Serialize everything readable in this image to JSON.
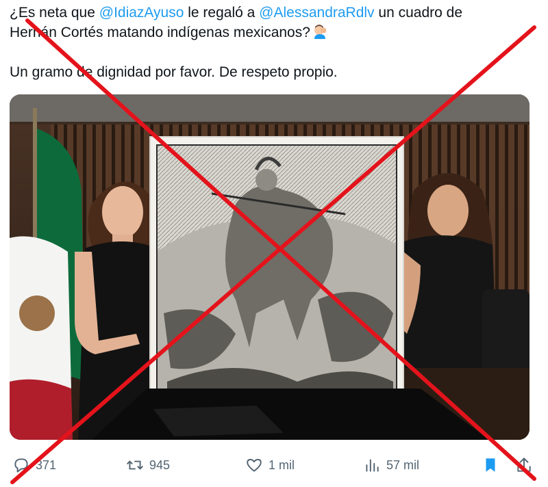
{
  "tweet": {
    "line1_prefix": "¿Es neta que ",
    "mention1": "@IdiazAyuso",
    "line1_mid": " le regaló a ",
    "mention2": "@AlessandraRdlv",
    "line1_suffix": " un cuadro de",
    "line2": "Hernán Cortés matando indígenas mexicanos?",
    "line3": "Un gramo de dignidad por favor. De respeto propio.",
    "emoji": "man-facepalming-emoji"
  },
  "media": {
    "description_icon": "photo"
  },
  "actions": {
    "replies": "371",
    "reposts": "945",
    "likes": "1 mil",
    "views": "57 mil"
  },
  "colors": {
    "mention": "#1d9bf0",
    "icon_gray": "#536471",
    "bookmark_active": "#1d9bf0",
    "cross": "#e4131b"
  }
}
